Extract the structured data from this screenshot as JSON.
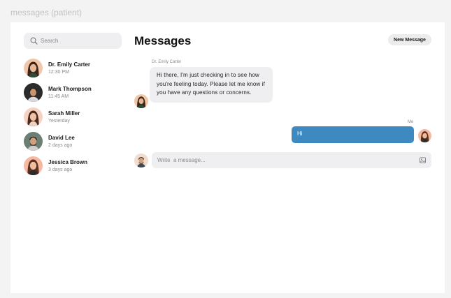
{
  "page_label": "messages (patient)",
  "sidebar": {
    "search_placeholder": "Search",
    "contacts": [
      {
        "name": "Dr. Emily Carter",
        "time": "12:30 PM"
      },
      {
        "name": "Mark Thompson",
        "time": "11:45 AM"
      },
      {
        "name": "Sarah Miller",
        "time": "Yesterday"
      },
      {
        "name": "David Lee",
        "time": "2 days ago"
      },
      {
        "name": "Jessica Brown",
        "time": "3 days ago"
      }
    ]
  },
  "main": {
    "title": "Messages",
    "new_message_label": "New Message",
    "conversation": {
      "incoming_sender": "Dr. Emily Carter",
      "incoming_text": "Hi there, I'm just checking in to see how you're feeling today. Please let me know if you have any questions or concerns.",
      "outgoing_sender": "Me",
      "outgoing_text": "Hi"
    },
    "composer_placeholder": "Write  a message..."
  },
  "colors": {
    "accent": "#3e8ac0",
    "bubble_gray": "#efeff1",
    "page_bg": "#f3f3f3"
  },
  "icons": {
    "search": "search-icon",
    "image": "image-icon"
  }
}
